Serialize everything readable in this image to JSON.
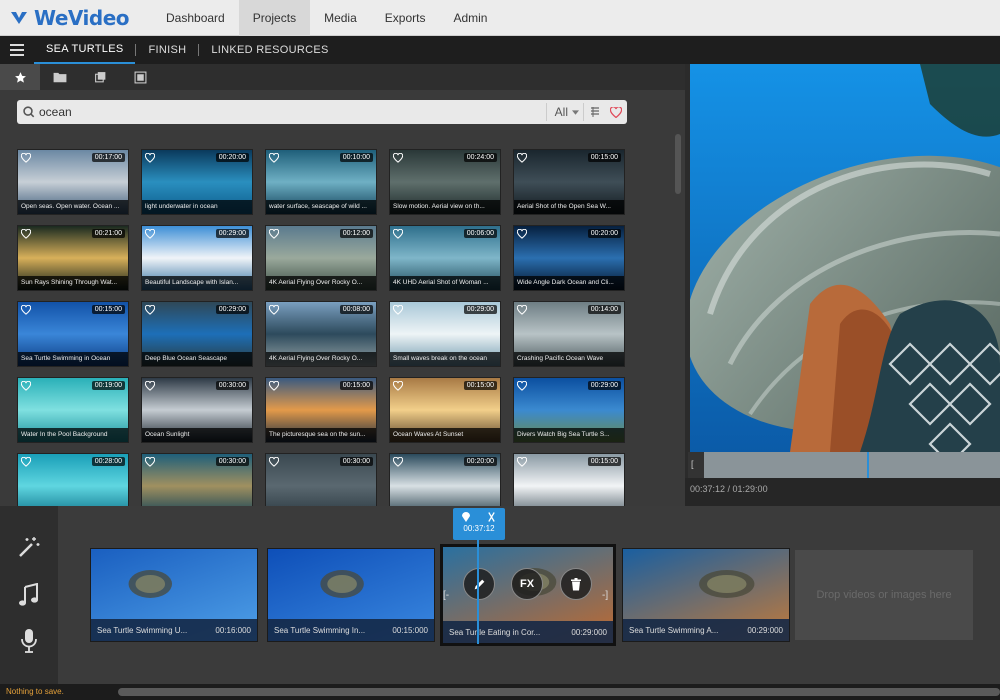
{
  "app": {
    "logo": "WeVideo"
  },
  "nav": [
    {
      "label": "Dashboard",
      "active": false
    },
    {
      "label": "Projects",
      "active": true
    },
    {
      "label": "Media",
      "active": false
    },
    {
      "label": "Exports",
      "active": false
    },
    {
      "label": "Admin",
      "active": false
    }
  ],
  "project_tabs": [
    {
      "label": "SEA TURTLES",
      "active": true
    },
    {
      "label": "FINISH",
      "active": false
    },
    {
      "label": "LINKED RESOURCES",
      "active": false
    }
  ],
  "media_tools": [
    "star-icon",
    "folder-icon",
    "layers-icon",
    "stack-icon"
  ],
  "search": {
    "value": "ocean",
    "filter": "All"
  },
  "thumbnails": [
    {
      "caption": "Open seas. Open water. Ocean ...",
      "duration": "00:17:00",
      "colors": [
        "#6b88a3",
        "#c7cfd6",
        "#3a5877"
      ]
    },
    {
      "caption": "light underwater in ocean",
      "duration": "00:20:00",
      "colors": [
        "#0a3a5c",
        "#2a8fbf",
        "#0c5b8a"
      ]
    },
    {
      "caption": "water surface, seascape of wild ...",
      "duration": "00:10:00",
      "colors": [
        "#1f5f7a",
        "#6fb0c4",
        "#0d3d55"
      ]
    },
    {
      "caption": "Slow motion. Aerial view on th...",
      "duration": "00:24:00",
      "colors": [
        "#2a3838",
        "#5f6f6c",
        "#1a2828"
      ]
    },
    {
      "caption": "Aerial Shot of the Open Sea W...",
      "duration": "00:15:00",
      "colors": [
        "#1a262e",
        "#3f4e57",
        "#10181d"
      ]
    },
    {
      "caption": "Sun Rays Shining Through Wat...",
      "duration": "00:21:00",
      "colors": [
        "#1a2a20",
        "#d8b05a",
        "#0e1c16"
      ]
    },
    {
      "caption": "Beautiful Landscape with Islan...",
      "duration": "00:29:00",
      "colors": [
        "#3d8fd6",
        "#f0f4f8",
        "#2f6fa0"
      ]
    },
    {
      "caption": "4K Aerial Flying Over Rocky O...",
      "duration": "00:12:00",
      "colors": [
        "#5a7a8e",
        "#9aa99c",
        "#3a4e44"
      ]
    },
    {
      "caption": "4K UHD Aerial Shot of Woman ...",
      "duration": "00:06:00",
      "colors": [
        "#2e6f8c",
        "#7fb6c9",
        "#1b4656"
      ]
    },
    {
      "caption": "Wide Angle Dark Ocean and Cli...",
      "duration": "00:20:00",
      "colors": [
        "#06203f",
        "#2b6fb0",
        "#03142a"
      ]
    },
    {
      "caption": "Sea Turtle Swimming in Ocean",
      "duration": "00:15:00",
      "colors": [
        "#1252a8",
        "#3a86d8",
        "#0b3a80"
      ]
    },
    {
      "caption": "Deep Blue Ocean Seascape",
      "duration": "00:29:00",
      "colors": [
        "#2f4858",
        "#1d6fb8",
        "#2a3a3a"
      ]
    },
    {
      "caption": "4K Aerial Flying Over Rocky O...",
      "duration": "00:08:00",
      "colors": [
        "#7a9fc0",
        "#2d4a5c",
        "#98a6a8"
      ]
    },
    {
      "caption": "Small waves break on the ocean",
      "duration": "00:29:00",
      "colors": [
        "#a9c8d8",
        "#eef4f6",
        "#6f98ad"
      ]
    },
    {
      "caption": "Crashing Pacific Ocean Wave",
      "duration": "00:14:00",
      "colors": [
        "#6e7e84",
        "#b8c3c6",
        "#4a585c"
      ]
    },
    {
      "caption": "Water In the Pool Background",
      "duration": "00:19:00",
      "colors": [
        "#2ab0b8",
        "#7fe0e0",
        "#1a8f9a"
      ]
    },
    {
      "caption": "Ocean Sunlight",
      "duration": "00:30:00",
      "colors": [
        "#2e3a46",
        "#c5ccd2",
        "#1c2630"
      ]
    },
    {
      "caption": "The picturesque sea on the sun...",
      "duration": "00:15:00",
      "colors": [
        "#3a5a80",
        "#e39a4a",
        "#1c2c40"
      ]
    },
    {
      "caption": "Ocean Waves At Sunset",
      "duration": "00:15:00",
      "colors": [
        "#a87a45",
        "#f2cf8a",
        "#5a4228"
      ]
    },
    {
      "caption": "Divers Watch Big Sea Turtle S...",
      "duration": "00:29:00",
      "colors": [
        "#0b4fa0",
        "#3b8ad0",
        "#6a8a4a"
      ]
    },
    {
      "caption": "",
      "duration": "00:28:00",
      "colors": [
        "#1a9fb8",
        "#5fd6e0",
        "#0b6f88"
      ]
    },
    {
      "caption": "",
      "duration": "00:30:00",
      "colors": [
        "#1f5f7a",
        "#a09060",
        "#0d3d55"
      ]
    },
    {
      "caption": "",
      "duration": "00:30:00",
      "colors": [
        "#3a4850",
        "#5a6870",
        "#2a3840"
      ]
    },
    {
      "caption": "",
      "duration": "00:20:00",
      "colors": [
        "#2a4a5c",
        "#d8e0e4",
        "#1a3440"
      ]
    },
    {
      "caption": "",
      "duration": "00:15:00",
      "colors": [
        "#8a9aa4",
        "#f2f4f6",
        "#4a5a64"
      ]
    }
  ],
  "preview": {
    "timecode": "00:37:12 / 01:29:00",
    "progress": 0.55
  },
  "timeline": {
    "playhead_time": "00:37:12",
    "clips": [
      {
        "caption": "Sea Turtle Swimming U...",
        "duration": "00:16:000",
        "colors": [
          "#1a5fc0",
          "#4fa0e8"
        ]
      },
      {
        "caption": "Sea Turtle Swimming In...",
        "duration": "00:15:000",
        "colors": [
          "#0e4fb8",
          "#3a88e0"
        ]
      },
      {
        "caption": "Sea Turtle Eating in Cor...",
        "duration": "00:29:000",
        "colors": [
          "#2a70a0",
          "#c06a30"
        ]
      },
      {
        "caption": "Sea Turtle Swimming A...",
        "duration": "00:29:000",
        "colors": [
          "#1a5fa0",
          "#c27a3a"
        ]
      }
    ],
    "clip_actions": [
      "FX"
    ],
    "dropzone": "Drop videos or images here"
  },
  "status": {
    "text": "Nothing to save."
  }
}
